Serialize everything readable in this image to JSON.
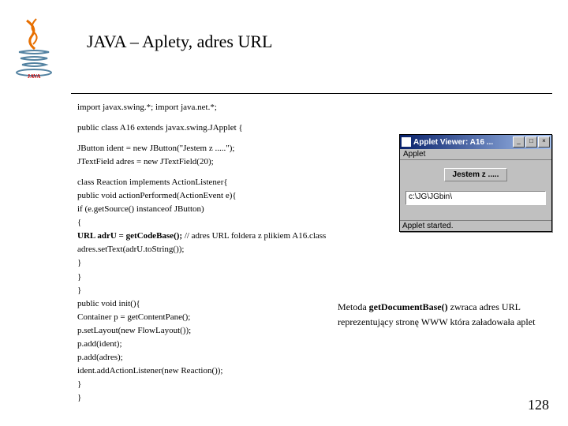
{
  "title": "JAVA – Aplety, adres URL",
  "code": {
    "imports": "import javax.swing.*;   import java.net.*;",
    "class_decl": "public class A16 extends javax.swing.JApplet {",
    "ident_decl": "JButton      ident = new JButton(\"Jestem z .....\");",
    "adres_decl": "JTextField   adres = new JTextField(20);",
    "reaction1": "class Reaction implements ActionListener{",
    "reaction2": "   public void actionPerformed(ActionEvent e){",
    "reaction3": "    if (e.getSource() instanceof JButton)",
    "reaction4": "       {",
    "reaction5a": "        URL adrU = getCodeBase();",
    "reaction5b": "          // adres URL foldera z plikiem A16.class",
    "reaction6": "        adres.setText(adrU.toString());",
    "reaction7": "       }",
    "reaction8": "    }",
    "reaction9": "  }",
    "init1": "public void init(){",
    "init2": "   Container p = getContentPane();",
    "init3": "   p.setLayout(new FlowLayout());",
    "init4": "   p.add(ident);",
    "init5": "   p.add(adres);",
    "init6": "   ident.addActionListener(new Reaction());",
    "init7": " }",
    "end": "}"
  },
  "applet": {
    "title": "Applet Viewer: A16 ...",
    "menu": "Applet",
    "button_label": "Jestem z .....",
    "field_value": "c:\\JG\\JGbin\\",
    "status": "Applet started.",
    "min": "_",
    "max": "□",
    "close": "×"
  },
  "note_prefix": "Metoda ",
  "note_bold": "getDocumentBase()",
  "note_rest1": " zwraca adres URL",
  "note_line2": "reprezentujący stronę WWW która załadowała aplet",
  "pagenum": "128"
}
